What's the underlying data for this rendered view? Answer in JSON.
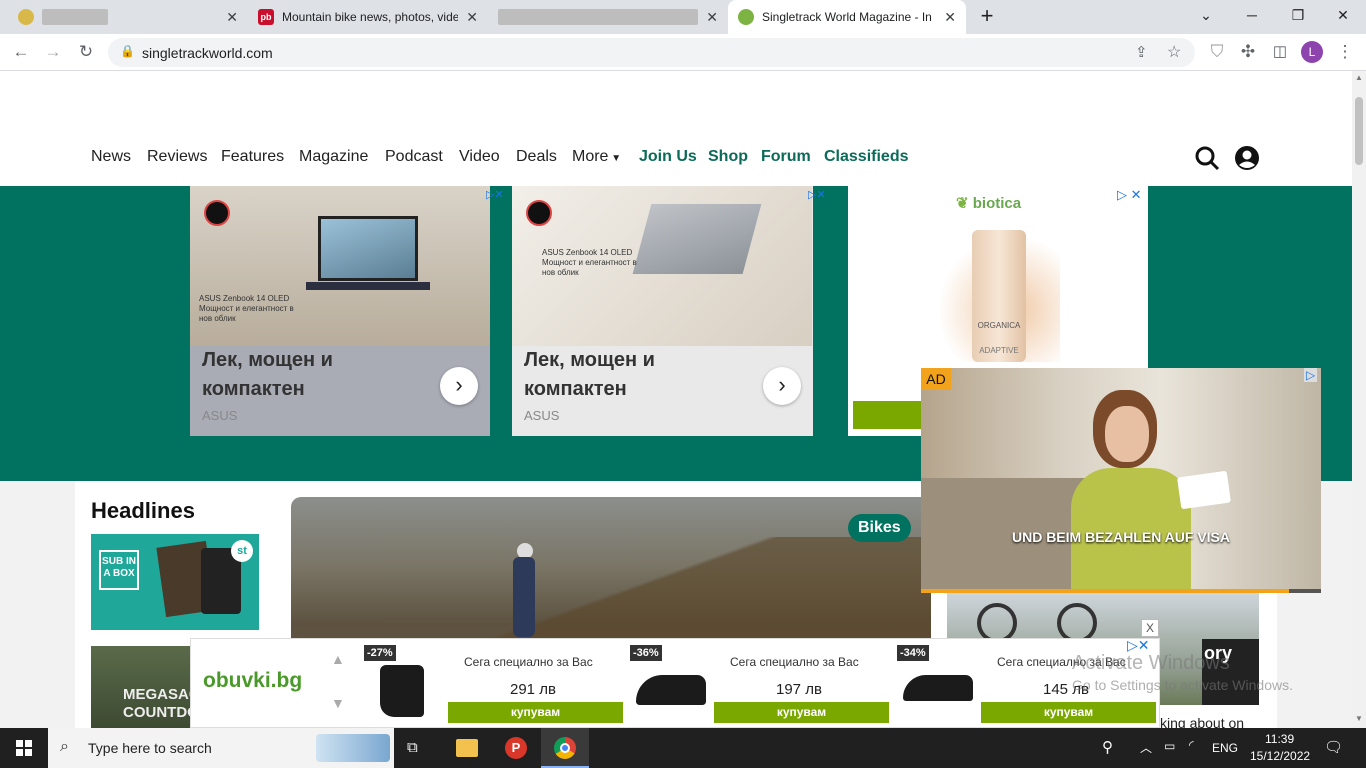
{
  "browser": {
    "tabs": [
      {
        "title": "",
        "redacted": true,
        "active": false
      },
      {
        "title": "Mountain bike news, photos, vide",
        "active": false
      },
      {
        "title": "",
        "redacted": true,
        "active": false
      },
      {
        "title": "Singletrack World Magazine - Ind",
        "active": true
      }
    ],
    "new_tab_icon": "plus-icon",
    "url": "singletrackworld.com",
    "profile_initial": "L"
  },
  "site": {
    "nav": [
      "News",
      "Reviews",
      "Features",
      "Magazine",
      "Podcast",
      "Video",
      "Deals",
      "More"
    ],
    "nav_highlight": [
      "Join Us",
      "Shop",
      "Forum",
      "Classifieds"
    ],
    "headlines_title": "Headlines",
    "thumb1_text": "SUB IN A BOX",
    "thumb2_text": "MEGASACK COUNTDOWN",
    "category_badge": "Bikes",
    "side_story_title_fragment": "ory",
    "side_story_snippet": "king about on",
    "accent_color": "#00725f"
  },
  "ads": {
    "asus1": {
      "product": "ASUS Zenbook 14 OLED",
      "tagline": "Мощност и елегантност в нов облик",
      "headline1": "Лек, мощен и",
      "headline2": "компактен",
      "brand": "ASUS"
    },
    "asus2": {
      "product": "ASUS Zenbook 14 OLED",
      "tagline": "Мощност и елегантност в нов облик",
      "headline1": "Лек, мощен и",
      "headline2": "компактен",
      "brand": "ASUS"
    },
    "biotica": {
      "brand": "biotica",
      "product_brand": "ORGANICA",
      "product_name": "ADAPTIVE"
    },
    "video": {
      "badge": "AD",
      "caption": "UND BEIM BEZAHLEN AUF VISA",
      "progress": 0.92
    },
    "obuvki": {
      "logo": "obuvki.bg",
      "close": "X",
      "products": [
        {
          "discount": "-27%",
          "tag": "Сега специално за Вас",
          "price": "291 лв",
          "button": "купувам"
        },
        {
          "discount": "-36%",
          "tag": "Сега специално за Вас",
          "price": "197 лв",
          "button": "купувам"
        },
        {
          "discount": "-34%",
          "tag": "Сега специално за Вас",
          "price": "145 лв",
          "button": "купувам"
        }
      ]
    }
  },
  "watermark": {
    "line1": "Activate Windows",
    "line2": "Go to Settings to activate Windows."
  },
  "taskbar": {
    "search_placeholder": "Type here to search",
    "language": "ENG",
    "time": "11:39",
    "date": "15/12/2022"
  }
}
